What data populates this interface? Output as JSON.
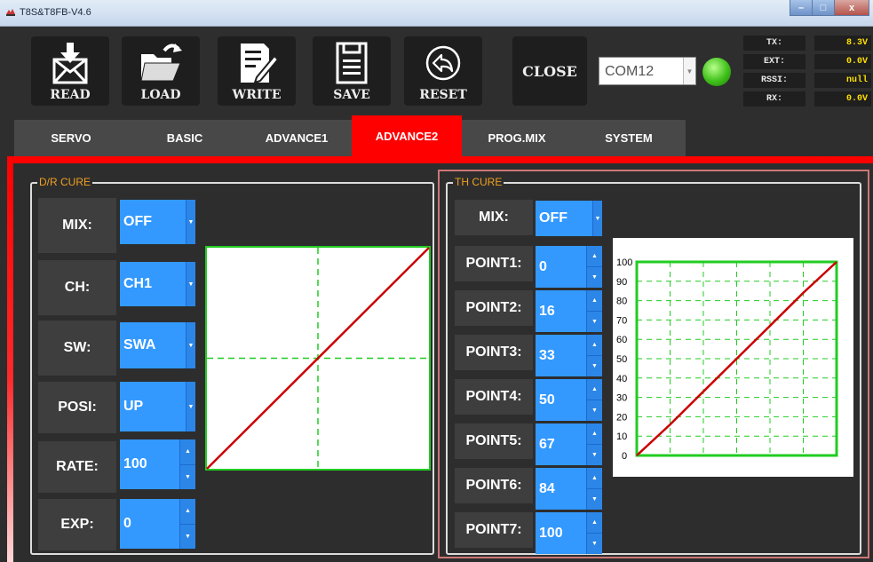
{
  "window": {
    "title": "T8S&T8FB-V4.6",
    "buttons": {
      "minimize": "–",
      "maximize": "□",
      "close": "x"
    }
  },
  "toolbar": {
    "read": "READ",
    "load": "LOAD",
    "write": "WRITE",
    "save": "SAVE",
    "reset": "RESET",
    "close": "CLOSE",
    "port": "COM12",
    "connected": true
  },
  "telemetry": [
    {
      "key": "TX:",
      "value": "8.3V"
    },
    {
      "key": "EXT:",
      "value": "0.0V"
    },
    {
      "key": "RSSI:",
      "value": "null"
    },
    {
      "key": "RX:",
      "value": "0.0V"
    }
  ],
  "tabs": [
    "SERVO",
    "BASIC",
    "ADVANCE1",
    "ADVANCE2",
    "PROG.MIX",
    "SYSTEM"
  ],
  "active_tab": "ADVANCE2",
  "dr_cure": {
    "title": "D/R CURE",
    "rows": [
      {
        "label": "MIX:",
        "value": "OFF",
        "control": "dropdown"
      },
      {
        "label": "CH:",
        "value": "CH1",
        "control": "dropdown"
      },
      {
        "label": "SW:",
        "value": "SWA",
        "control": "dropdown"
      },
      {
        "label": "POSI:",
        "value": "UP",
        "control": "dropdown"
      },
      {
        "label": "RATE:",
        "value": "100",
        "control": "spinner"
      },
      {
        "label": "EXP:",
        "value": "0",
        "control": "spinner"
      }
    ]
  },
  "th_cure": {
    "title": "TH CURE",
    "mix": {
      "label": "MIX:",
      "value": "OFF"
    },
    "points": [
      {
        "label": "POINT1:",
        "value": "0"
      },
      {
        "label": "POINT2:",
        "value": "16"
      },
      {
        "label": "POINT3:",
        "value": "33"
      },
      {
        "label": "POINT4:",
        "value": "50"
      },
      {
        "label": "POINT5:",
        "value": "67"
      },
      {
        "label": "POINT6:",
        "value": "84"
      },
      {
        "label": "POINT7:",
        "value": "100"
      }
    ]
  },
  "chart_data": [
    {
      "type": "line",
      "x": [
        -100,
        100
      ],
      "series": [
        {
          "values": [
            -100,
            100
          ]
        }
      ],
      "grid": "center crosshair",
      "colors": {
        "line": "#cc0000",
        "grid": "#22cc22",
        "frame": "#22cc22"
      }
    },
    {
      "type": "line",
      "x": [
        0,
        16.7,
        33.3,
        50,
        66.7,
        83.3,
        100
      ],
      "series": [
        {
          "values": [
            0,
            16,
            33,
            50,
            67,
            84,
            100
          ]
        }
      ],
      "y_ticks": [
        "0",
        "10",
        "20",
        "30",
        "40",
        "50",
        "60",
        "70",
        "80",
        "90",
        "100"
      ],
      "ylim": [
        0,
        100
      ],
      "grid": true,
      "colors": {
        "line": "#cc0000",
        "grid": "#22cc22",
        "frame": "#22cc22"
      }
    }
  ]
}
